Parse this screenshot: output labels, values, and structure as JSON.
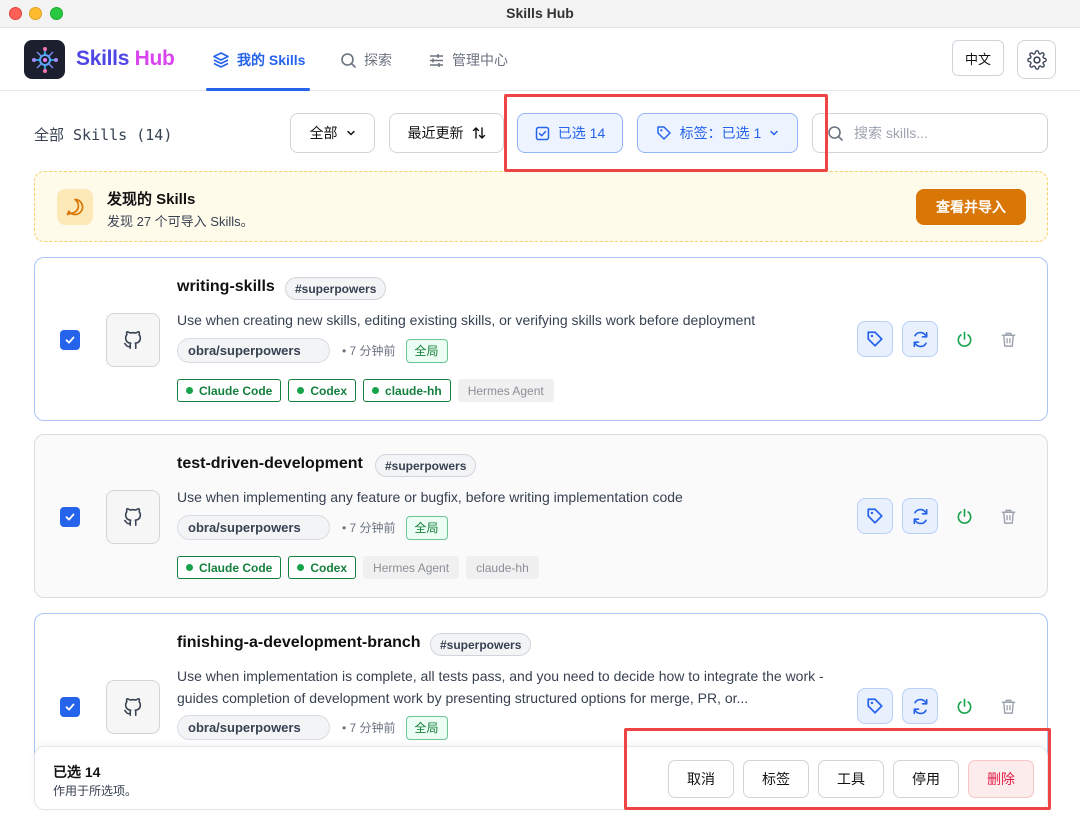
{
  "window": {
    "title": "Skills Hub"
  },
  "header": {
    "brand_part1": "Skills",
    "brand_part2": "Hub",
    "nav": [
      {
        "label": "我的 Skills",
        "icon": "layers-icon",
        "active": true
      },
      {
        "label": "探索",
        "icon": "search-icon",
        "active": false
      },
      {
        "label": "管理中心",
        "icon": "sliders-icon",
        "active": false
      }
    ],
    "lang_label": "中文"
  },
  "toolbar": {
    "title": "全部 Skills (14)",
    "filter_label": "全部",
    "sort_label": "最近更新",
    "selected_label": "已选 14",
    "tag_filter_label": "标签：已选 1",
    "search_placeholder": "搜索 skills...",
    "search_value": ""
  },
  "banner": {
    "title": "发现的 Skills",
    "subtitle": "发现 27 个可导入 Skills。",
    "button_label": "查看并导入"
  },
  "skills": [
    {
      "name": "writing-skills",
      "group": "#superpowers",
      "desc": "Use when creating new skills, editing existing skills, or verifying skills work before deployment",
      "repo": "obra/superpowers",
      "time": "• 7 分钟前",
      "scope": "全局",
      "tools_on": [
        "Claude Code",
        "Codex",
        "claude-hh"
      ],
      "tools_off": [
        "Hermes Agent"
      ]
    },
    {
      "name": "test-driven-development",
      "group": "#superpowers",
      "desc": "Use when implementing any feature or bugfix, before writing implementation code",
      "repo": "obra/superpowers",
      "time": "• 7 分钟前",
      "scope": "全局",
      "tools_on": [
        "Claude Code",
        "Codex"
      ],
      "tools_off": [
        "Hermes Agent",
        "claude-hh"
      ]
    },
    {
      "name": "finishing-a-development-branch",
      "group": "#superpowers",
      "desc": "Use when implementation is complete, all tests pass, and you need to decide how to integrate the work - guides completion of development work by presenting structured options for merge, PR, or...",
      "repo": "obra/superpowers",
      "time": "• 7 分钟前",
      "scope": "全局",
      "tools_on": [],
      "tools_off": []
    }
  ],
  "bulk": {
    "title": "已选 14",
    "subtitle": "作用于所选项。",
    "buttons": [
      "取消",
      "标签",
      "工具",
      "停用",
      "删除"
    ]
  },
  "colors": {
    "accent": "#2563eb",
    "brand_purple": "#4f46e5",
    "brand_pink": "#d946ef",
    "banner_button": "#d97706",
    "enabled_green": "#15803d",
    "danger": "#e11d48",
    "highlight": "#ef4444"
  }
}
